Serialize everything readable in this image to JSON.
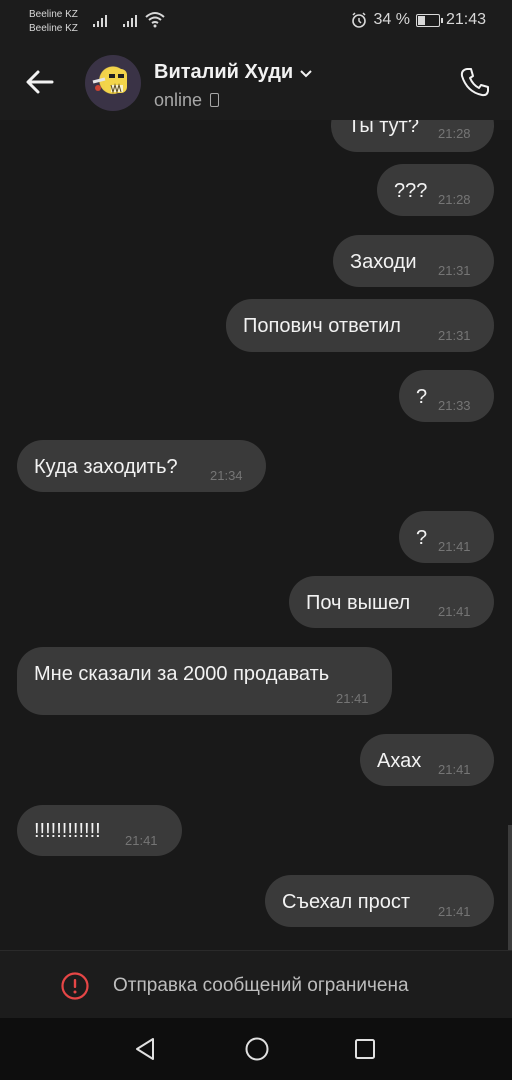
{
  "status_bar": {
    "carrier_1": "Beeline KZ",
    "carrier_2": "Beeline KZ",
    "battery_percent": "34 %",
    "battery_level": 0.34,
    "time": "21:43"
  },
  "header": {
    "contact_name": "Виталий Худи",
    "presence": "online"
  },
  "messages": [
    {
      "id": "m1",
      "side": "out",
      "text": "Ты тут?",
      "time": "21:28"
    },
    {
      "id": "m2",
      "side": "out",
      "text": "???",
      "time": "21:28"
    },
    {
      "id": "m3",
      "side": "out",
      "text": "Заходи",
      "time": "21:31"
    },
    {
      "id": "m4",
      "side": "out",
      "text": "Попович ответил",
      "time": "21:31"
    },
    {
      "id": "m5",
      "side": "out",
      "text": "?",
      "time": "21:33"
    },
    {
      "id": "m6",
      "side": "in",
      "text": "Куда заходить?",
      "time": "21:34"
    },
    {
      "id": "m7",
      "side": "out",
      "text": "?",
      "time": "21:41"
    },
    {
      "id": "m8",
      "side": "out",
      "text": "Поч вышел",
      "time": "21:41"
    },
    {
      "id": "m9",
      "side": "in",
      "text": "Мне сказали за 2000 продавать",
      "time": "21:41"
    },
    {
      "id": "m10",
      "side": "out",
      "text": "Ахах",
      "time": "21:41"
    },
    {
      "id": "m11",
      "side": "in",
      "text": "!!!!!!!!!!!!",
      "time": "21:41"
    },
    {
      "id": "m12",
      "side": "out",
      "text": "Съехал прост",
      "time": "21:41"
    }
  ],
  "footer": {
    "restriction_text": "Отправка сообщений ограничена",
    "icon": "alert-circle-icon",
    "icon_color": "#e64646"
  },
  "colors": {
    "background": "#191919",
    "bubble": "#3a3a3a"
  }
}
